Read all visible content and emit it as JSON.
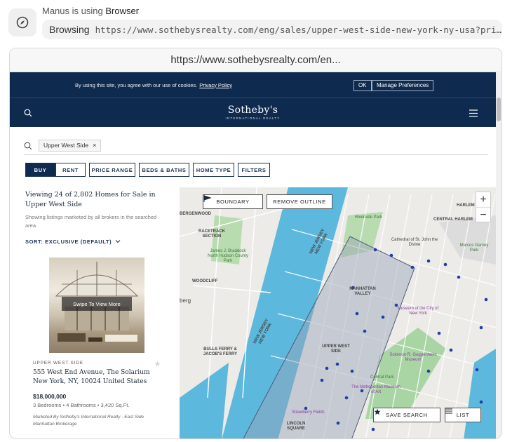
{
  "agent": {
    "prefix": "Manus is using",
    "tool": "Browser",
    "action_verb": "Browsing",
    "action_url": "https://www.sothebysrealty.com/eng/sales/upper-west-side-new-york-ny-usa?price..."
  },
  "browser": {
    "url": "https://www.sothebysrealty.com/en..."
  },
  "cookie": {
    "text": "By using this site, you agree with our use of cookies.",
    "link": "Privacy Policy",
    "ok": "OK",
    "manage": "Manage Preferences"
  },
  "nav": {
    "brand": "Sotheby's",
    "brand_sub": "INTERNATIONAL REALTY"
  },
  "search": {
    "chip": "Upper West Side",
    "chip_remove": "×"
  },
  "filters": {
    "buy": "BUY",
    "rent": "RENT",
    "price_range": "PRICE RANGE",
    "beds_baths": "BEDS & BATHS",
    "home_type": "HOME TYPE",
    "more": "FILTERS"
  },
  "results": {
    "title": "Viewing 24 of 2,802 Homes for Sale in Upper West Side",
    "subtitle": "Showing listings marketed by all brokers in the searched area.",
    "sort": "SORT: EXCLUSIVE (DEFAULT)"
  },
  "listing": {
    "swipe": "Swipe To View More",
    "area": "UPPER WEST SIDE",
    "address": "555 West End Avenue, The Solarium New York, NY, 10024 United States",
    "price": "$18,000,000",
    "specs": "3 Bedrooms • 4 Bathrooms • 3,420 Sq.Ft.",
    "marketed": "Marketed By Sotheby's International Realty - East Side Manhattan Brokerage"
  },
  "map": {
    "boundary": "BOUNDARY",
    "remove_outline": "REMOVE OUTLINE",
    "zoom_in": "+",
    "zoom_out": "−",
    "save_search": "SAVE SEARCH",
    "list": "LIST",
    "labels": {
      "bergenwood": "BERGENWOOD",
      "racetrack": "RACETRACK SECTION",
      "braddock": "James J. Braddock North Hudson County Park",
      "woodcliff": "WOODCLIFF",
      "berg": "berg",
      "bulls_ferry": "BULLS FERRY & JACOB'S FERRY",
      "nj1": "NEW JERSEY NEW YORK",
      "nj2": "NEW JERSEY NEW YORK",
      "riverside": "Riverside Park",
      "cathedral": "Cathedral of St. John the Divine",
      "manhattan_valley": "MANHATTAN VALLEY",
      "museum_cny": "Museum of the City of New York",
      "upper_west_side": "UPPER WEST SIDE",
      "guggenheim": "Solomon R. Guggenheim Museum",
      "central_park": "Central Park",
      "met": "The Metropolitan Museum of Art",
      "strawberry": "Strawberry Fields",
      "lincoln": "LINCOLN SQUARE",
      "harlem": "HARLEM",
      "central_harlem": "CENTRAL HARLEM",
      "marcus_garvey": "Marcus Garvey Park"
    }
  }
}
